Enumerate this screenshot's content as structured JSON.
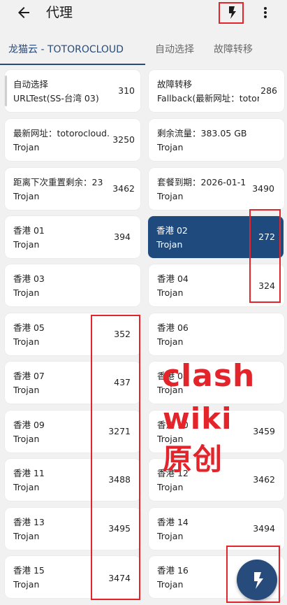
{
  "header": {
    "title": "代理",
    "back_icon": "arrow-left-icon",
    "bolt_icon": "lightning-bolt-icon",
    "more_icon": "more-vertical-icon"
  },
  "tabs": [
    {
      "label": "龙猫云 - TOTOROCLOUD",
      "active": true
    },
    {
      "label": "自动选择",
      "active": false
    },
    {
      "label": "故障转移",
      "active": false
    }
  ],
  "proxies": [
    {
      "name": "自动选择",
      "sub": "URLTest(SS-台湾 03)",
      "delay": "310"
    },
    {
      "name": "故障转移",
      "sub": "Fallback(最新网址：totor",
      "delay": "286"
    },
    {
      "name": "最新网址：totorocloud.",
      "sub": "Trojan",
      "delay": "3250"
    },
    {
      "name": "剩余流量：383.05 GB",
      "sub": "Trojan",
      "delay": ""
    },
    {
      "name": "距离下次重置剩余：23",
      "sub": "Trojan",
      "delay": "3462"
    },
    {
      "name": "套餐到期：2026-01-1",
      "sub": "Trojan",
      "delay": "3490"
    },
    {
      "name": "香港 01",
      "sub": "Trojan",
      "delay": "394"
    },
    {
      "name": "香港 02",
      "sub": "Trojan",
      "delay": "272",
      "selected": true
    },
    {
      "name": "香港 03",
      "sub": "Trojan",
      "delay": ""
    },
    {
      "name": "香港 04",
      "sub": "Trojan",
      "delay": "324"
    },
    {
      "name": "香港 05",
      "sub": "Trojan",
      "delay": "352"
    },
    {
      "name": "香港 06",
      "sub": "Trojan",
      "delay": ""
    },
    {
      "name": "香港 07",
      "sub": "Trojan",
      "delay": "437"
    },
    {
      "name": "香港 08",
      "sub": "Trojan",
      "delay": ""
    },
    {
      "name": "香港 09",
      "sub": "Trojan",
      "delay": "3271"
    },
    {
      "name": "香港 10",
      "sub": "Trojan",
      "delay": "3459"
    },
    {
      "name": "香港 11",
      "sub": "Trojan",
      "delay": "3488"
    },
    {
      "name": "香港 12",
      "sub": "Trojan",
      "delay": "3462"
    },
    {
      "name": "香港 13",
      "sub": "Trojan",
      "delay": "3495"
    },
    {
      "name": "香港 14",
      "sub": "Trojan",
      "delay": "3494"
    },
    {
      "name": "香港 15",
      "sub": "Trojan",
      "delay": "3474"
    },
    {
      "name": "香港 16",
      "sub": "Trojan",
      "delay": ""
    }
  ],
  "watermark": {
    "line1": "clash",
    "line2": "wiki",
    "line3": "原创"
  },
  "fab": {
    "icon": "lightning-bolt-icon"
  },
  "colors": {
    "accent": "#274b7b",
    "selected_card": "#1f4a7e",
    "annotation_red": "#e3242b",
    "background": "#f1f1f1"
  }
}
